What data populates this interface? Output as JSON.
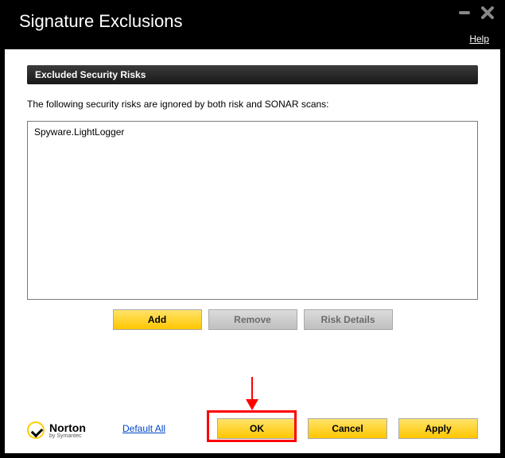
{
  "window": {
    "title": "Signature Exclusions",
    "help": "Help"
  },
  "section": {
    "header": "Excluded Security Risks",
    "description": "The following security risks are ignored by both risk and SONAR scans:"
  },
  "list": {
    "items": [
      "Spyware.LightLogger"
    ]
  },
  "buttons": {
    "add": "Add",
    "remove": "Remove",
    "risk_details": "Risk Details",
    "default_all": "Default All",
    "ok": "OK",
    "cancel": "Cancel",
    "apply": "Apply"
  },
  "branding": {
    "name": "Norton",
    "sub": "by Symantec"
  },
  "annotation": {
    "arrow_target": "ok-button"
  }
}
